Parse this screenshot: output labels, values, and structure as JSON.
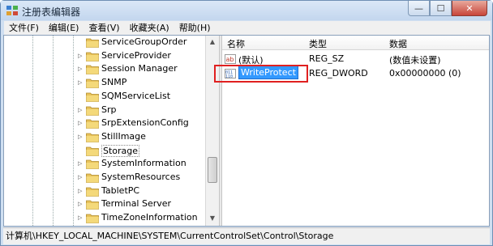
{
  "window": {
    "title": "注册表编辑器",
    "minimize_glyph": "—",
    "maximize_glyph": "☐",
    "close_glyph": "✕"
  },
  "menu": [
    "文件(F)",
    "编辑(E)",
    "查看(V)",
    "收藏夹(A)",
    "帮助(H)"
  ],
  "tree": {
    "items": [
      {
        "label": "ServiceGroupOrder",
        "expandable": false,
        "selected": false
      },
      {
        "label": "ServiceProvider",
        "expandable": true,
        "selected": false
      },
      {
        "label": "Session Manager",
        "expandable": true,
        "selected": false
      },
      {
        "label": "SNMP",
        "expandable": true,
        "selected": false
      },
      {
        "label": "SQMServiceList",
        "expandable": false,
        "selected": false
      },
      {
        "label": "Srp",
        "expandable": true,
        "selected": false
      },
      {
        "label": "SrpExtensionConfig",
        "expandable": true,
        "selected": false
      },
      {
        "label": "StillImage",
        "expandable": true,
        "selected": false
      },
      {
        "label": "Storage",
        "expandable": false,
        "selected": true
      },
      {
        "label": "SystemInformation",
        "expandable": true,
        "selected": false
      },
      {
        "label": "SystemResources",
        "expandable": true,
        "selected": false
      },
      {
        "label": "TabletPC",
        "expandable": true,
        "selected": false
      },
      {
        "label": "Terminal Server",
        "expandable": true,
        "selected": false
      },
      {
        "label": "TimeZoneInformation",
        "expandable": true,
        "selected": false
      }
    ]
  },
  "list": {
    "headers": {
      "name": "名称",
      "type": "类型",
      "data": "数据"
    },
    "rows": [
      {
        "name": "(默认)",
        "type": "REG_SZ",
        "data": "(数值未设置)",
        "icon": "string-value-icon"
      },
      {
        "name": "WriteProtect",
        "type": "REG_DWORD",
        "data": "0x00000000 (0)",
        "icon": "binary-value-icon"
      }
    ]
  },
  "status": {
    "path": "计算机\\HKEY_LOCAL_MACHINE\\SYSTEM\\CurrentControlSet\\Control\\Storage"
  },
  "colors": {
    "selection": "#3399ff",
    "highlight_box": "#e02020",
    "folder": "#e8c25a"
  }
}
